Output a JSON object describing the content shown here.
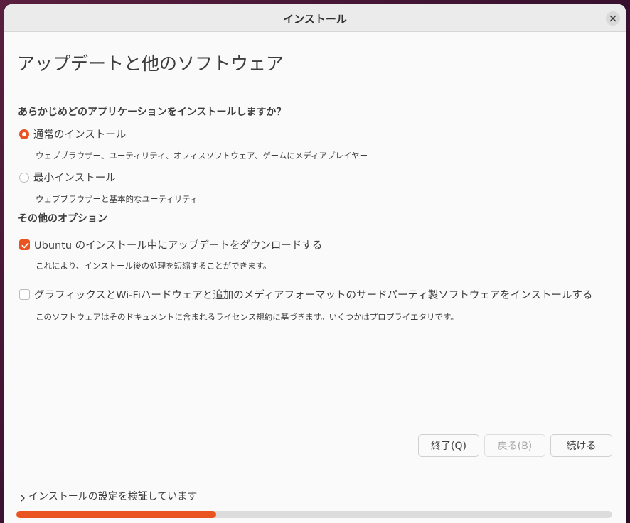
{
  "window": {
    "title": "インストール"
  },
  "header": {
    "page_title": "アップデートと他のソフトウェア"
  },
  "install_type": {
    "question": "あらかじめどのアプリケーションをインストールしますか？",
    "options": [
      {
        "label": "通常のインストール",
        "description": "ウェブブラウザー、ユーティリティ、オフィスソフトウェア、ゲームにメディアプレイヤー",
        "selected": true
      },
      {
        "label": "最小インストール",
        "description": "ウェブブラウザーと基本的なユーティリティ",
        "selected": false
      }
    ]
  },
  "other_options": {
    "heading": "その他のオプション",
    "items": [
      {
        "label": "Ubuntu のインストール中にアップデートをダウンロードする",
        "description": "これにより、インストール後の処理を短縮することができます。",
        "checked": true
      },
      {
        "label": "グラフィックスとWi-Fiハードウェアと追加のメディアフォーマットのサードパーティ製ソフトウェアをインストールする",
        "description": "このソフトウェアはそのドキュメントに含まれるライセンス規約に基づきます。いくつかはプロプライエタリです。",
        "checked": false
      }
    ]
  },
  "buttons": {
    "quit": "終了(Q)",
    "back": "戻る(B)",
    "continue": "続ける"
  },
  "status": {
    "text": "インストールの設定を検証しています",
    "progress": 0.335
  },
  "colors": {
    "accent": "#e95420",
    "window_bg": "#fafafa",
    "titlebar_bg": "#ebebeb",
    "track_bg": "#dcdcdc"
  },
  "icons": {
    "close": "close-icon",
    "check": "check-icon",
    "expander": "chevron-right-icon"
  }
}
